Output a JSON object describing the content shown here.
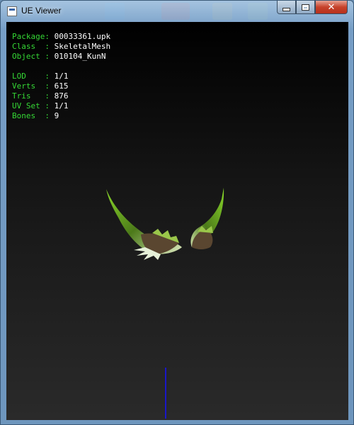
{
  "window": {
    "title": "UE Viewer",
    "controls": {
      "minimize": "minimize",
      "maximize": "maximize",
      "close": "✕"
    }
  },
  "info": {
    "group1": [
      {
        "label": "Package: ",
        "value": "00033361.upk"
      },
      {
        "label": "Class  : ",
        "value": "SkeletalMesh"
      },
      {
        "label": "Object : ",
        "value": "010104_KunN"
      }
    ],
    "group2": [
      {
        "label": "LOD    : ",
        "value": "1/1"
      },
      {
        "label": "Verts  : ",
        "value": "615"
      },
      {
        "label": "Tris   : ",
        "value": "876"
      },
      {
        "label": "UV Set : ",
        "value": "1/1"
      },
      {
        "label": "Bones  : ",
        "value": "9"
      }
    ]
  },
  "colors": {
    "label_green": "#35d835",
    "value_white": "#ffffff",
    "axis_blue": "#1a16c8",
    "mesh_green": "#7ed321",
    "mesh_brown": "#5a4630"
  },
  "icons": [
    "app-icon",
    "minimize-icon",
    "maximize-icon",
    "close-icon"
  ]
}
